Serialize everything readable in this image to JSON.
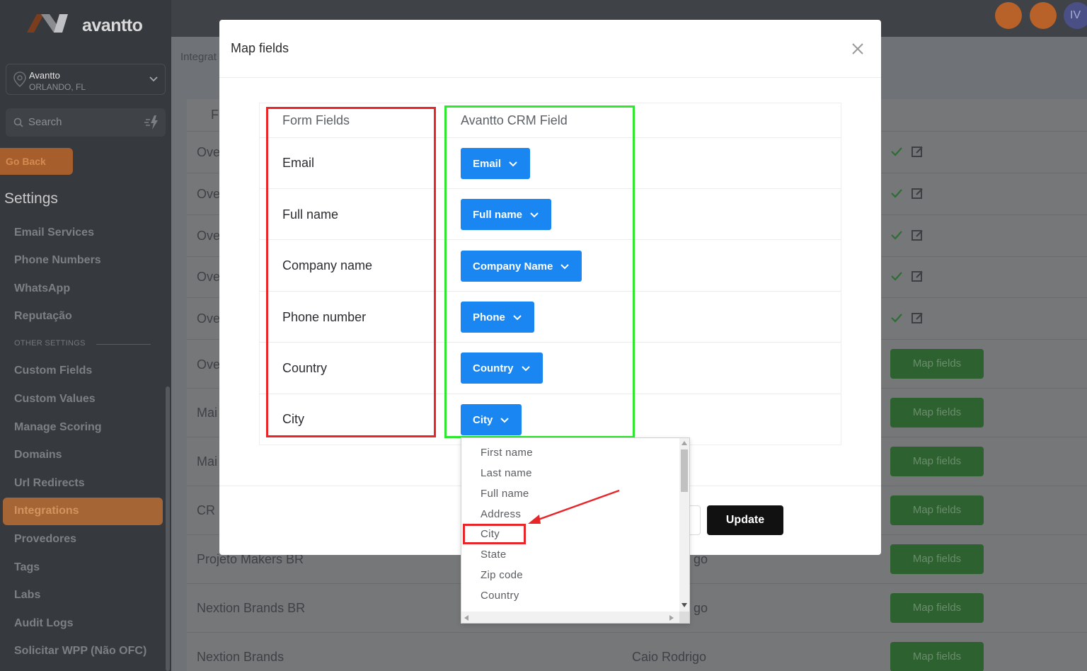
{
  "app": {
    "brand": "avantto",
    "location_name": "Avantto",
    "location_city": "ORLANDO, FL",
    "search_placeholder": "Search",
    "go_back": "Go Back",
    "user_initials": "IV"
  },
  "sidebar": {
    "section_title": "Settings",
    "items": [
      {
        "label": "Email Services"
      },
      {
        "label": "Phone Numbers"
      },
      {
        "label": "WhatsApp"
      },
      {
        "label": "Reputação"
      }
    ],
    "other_settings_label": "OTHER SETTINGS",
    "other_items": [
      {
        "label": "Custom Fields"
      },
      {
        "label": "Custom Values"
      },
      {
        "label": "Manage Scoring"
      },
      {
        "label": "Domains"
      },
      {
        "label": "Url Redirects"
      },
      {
        "label": "Integrations",
        "active": true
      },
      {
        "label": "Provedores"
      },
      {
        "label": "Tags"
      },
      {
        "label": "Labs"
      },
      {
        "label": "Audit Logs"
      },
      {
        "label": "Solicitar WPP (Não OFC)"
      }
    ]
  },
  "background": {
    "breadcrumb": "Integrat",
    "header_fragment": "F",
    "rows": [
      {
        "name": "Ove"
      },
      {
        "name": "Ove"
      },
      {
        "name": "Ove"
      },
      {
        "name": "Ove"
      },
      {
        "name": "Ove"
      },
      {
        "name": "Ove",
        "action": "Map fields"
      },
      {
        "name": "Mai",
        "action": "Map fields"
      },
      {
        "name": "Mai",
        "action": "Map fields"
      },
      {
        "name": "CR",
        "action": "Map fields"
      },
      {
        "name": "Projeto Makers BR",
        "owner": "go",
        "action": "Map fields"
      },
      {
        "name": "Nextion Brands BR",
        "owner": "go",
        "action": "Map fields"
      },
      {
        "name": "Nextion Brands",
        "owner": "Caio Rodrigo",
        "action": "Map fields"
      }
    ]
  },
  "modal": {
    "title": "Map fields",
    "col_form": "Form Fields",
    "col_crm": "Avantto CRM Field",
    "rows": [
      {
        "form": "Email",
        "crm": "Email"
      },
      {
        "form": "Full name",
        "crm": "Full name"
      },
      {
        "form": "Company name",
        "crm": "Company Name"
      },
      {
        "form": "Phone number",
        "crm": "Phone"
      },
      {
        "form": "Country",
        "crm": "Country"
      },
      {
        "form": "City",
        "crm": "City"
      }
    ],
    "update_label": "Update"
  },
  "dropdown": {
    "options": [
      "First name",
      "Last name",
      "Full name",
      "Address",
      "City",
      "State",
      "Zip code",
      "Country"
    ],
    "highlighted": "City"
  },
  "colors": {
    "primary_button": "#1a86f2",
    "annotation_red": "#e8262a",
    "annotation_green": "#2ee82e",
    "sidebar_active": "#a66535"
  }
}
